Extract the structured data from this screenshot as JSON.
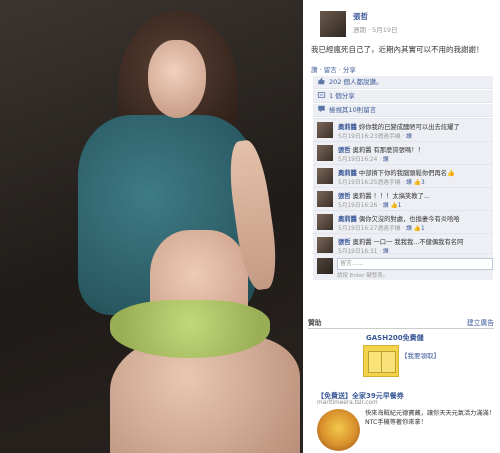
{
  "post": {
    "author": "張哲",
    "meta_prefix": "週期",
    "date": "5月19日",
    "text": "我已經瘋死自己了，近期內其實可以不用的我謝謝！",
    "actions": "讚 · 留言 · 分享"
  },
  "likes": {
    "text": "202 個人都說讚。"
  },
  "shares": {
    "text": "1 個分享"
  },
  "view_more": {
    "text": "檢視其10則留言"
  },
  "comments": [
    {
      "name": "奧莉醬",
      "text": "妳你我的已變成醜陋可以出去炫耀了",
      "meta": "5月19日16:23透過手機 ·",
      "like": "讚"
    },
    {
      "name": "張哲",
      "text": "奧莉醬 有那麼誇張嗎！！",
      "meta": "5月19日16:24 ·",
      "like": "讚"
    },
    {
      "name": "奧莉醬",
      "text": "中部擠下你的我腦頭鬆你們再名👍",
      "meta": "5月19日16:25透過手機 ·",
      "like": "讚 👍3"
    },
    {
      "name": "張哲",
      "text": "奧莉醬 ！！！太搞笑教了...",
      "meta": "5月19日16:26 ·",
      "like": "讚 👍1"
    },
    {
      "name": "奧莉醬",
      "text": "偶你欠沒的對處，也換妻今有炎哈哈",
      "meta": "5月19日16:27透過手機 ·",
      "like": "讚 👍1"
    },
    {
      "name": "張哲",
      "text": "奧莉醬 一口一 我我我...不健偶我有名阿",
      "meta": "5月19日16:31 ·",
      "like": "讚"
    }
  ],
  "reply": {
    "placeholder": "留言......",
    "hint": "請按 Enter 鍵發表。"
  },
  "ads": {
    "header": "贊助",
    "create_link": "建立廣告",
    "ad1_title": "GASH200免費儲",
    "ad1_link": "【我要領取】",
    "ad2_title": "【免費送】全家39元早餐券",
    "ad2_url": "maritimeera.tslr.com",
    "ad2_desc": "快來海賊紀元德寶藏，讓你天天元氣活力滿滿！NTC手機等著你來拿！"
  },
  "colors": {
    "link": "#3b5998",
    "panel_bg": "#ffffff",
    "comment_bg": "#edeff4"
  }
}
